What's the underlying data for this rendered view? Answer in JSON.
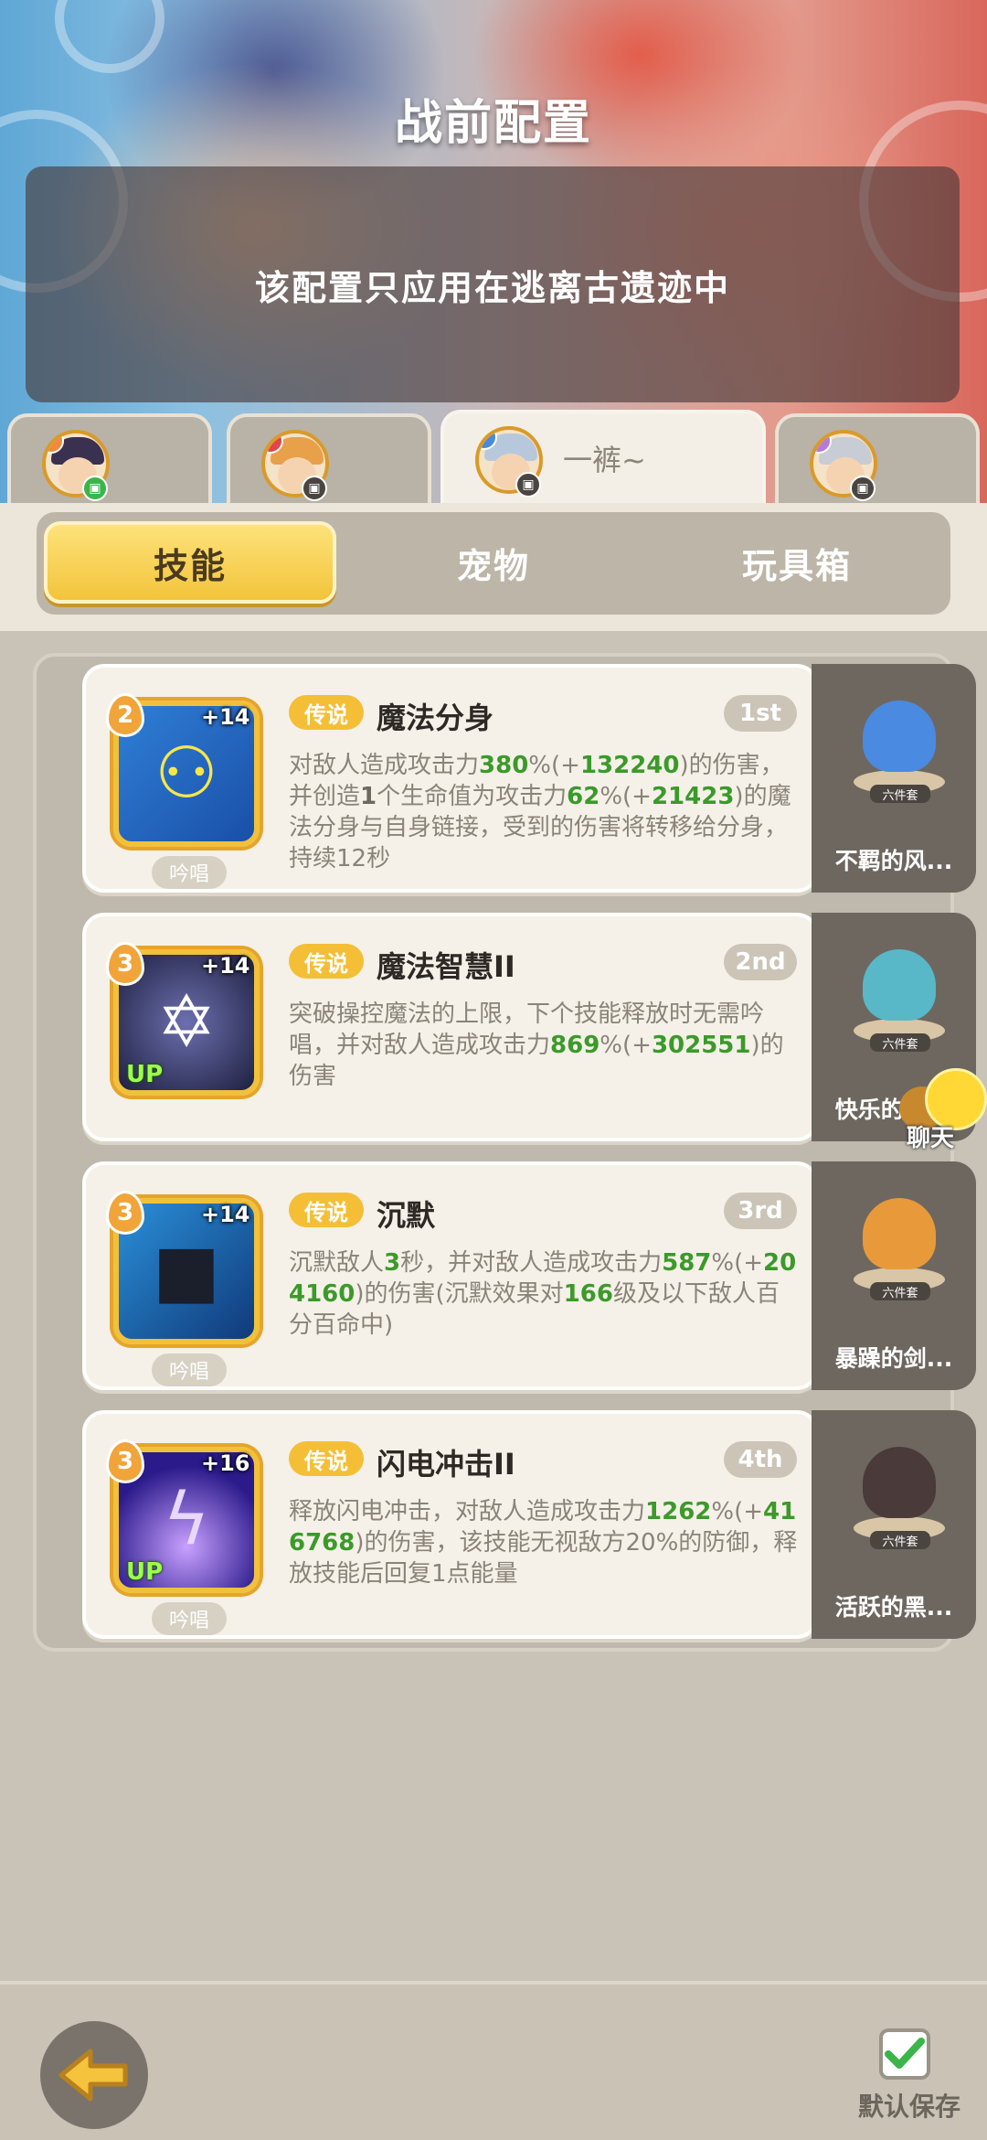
{
  "header": {
    "title": "战前配置",
    "notice": "该配置只应用在逃离古遗迹中"
  },
  "char_tabs": [
    {
      "name": "",
      "active": false,
      "badge": "green"
    },
    {
      "name": "",
      "active": false,
      "badge": "dark"
    },
    {
      "name": "一裤~",
      "active": true,
      "badge": "dark"
    },
    {
      "name": "",
      "active": false,
      "badge": "dark"
    }
  ],
  "sub_tabs": {
    "skills": "技能",
    "pets": "宠物",
    "toybox": "玩具箱"
  },
  "skills": [
    {
      "level": "2",
      "plus": "+14",
      "up": "",
      "chant": "吟唱",
      "rarity": "传说",
      "name": "魔法分身",
      "rank": "1st",
      "desc_parts": [
        "对敌人造成攻击力",
        "380",
        "%(+",
        "132240",
        ")的伤害，并创造",
        "1",
        "个生命值为攻击力",
        "62",
        "%(+",
        "21423",
        ")的魔法分身与自身链接，受到的伤害将转移给分身，持续12秒"
      ],
      "pet_name": "不羁的风...",
      "set": "六件套"
    },
    {
      "level": "3",
      "plus": "+14",
      "up": "UP",
      "chant": "",
      "rarity": "传说",
      "name": "魔法智慧II",
      "rank": "2nd",
      "desc_parts": [
        "突破操控魔法的上限，下个技能释放时无需吟唱，并对敌人造成攻击力",
        "869",
        "%(+",
        "302551",
        ")的伤害"
      ],
      "pet_name": "快乐的雪...",
      "set": "六件套"
    },
    {
      "level": "3",
      "plus": "+14",
      "up": "",
      "chant": "吟唱",
      "rarity": "传说",
      "name": "沉默",
      "rank": "3rd",
      "desc_parts": [
        "沉默敌人",
        "3",
        "秒，并对敌人造成攻击力",
        "587",
        "%(+",
        "204160",
        ")的伤害(沉默效果对",
        "166",
        "级及以下敌人百分百命中)"
      ],
      "pet_name": "暴躁的剑...",
      "set": "六件套"
    },
    {
      "level": "3",
      "plus": "+16",
      "up": "UP",
      "chant": "吟唱",
      "rarity": "传说",
      "name": "闪电冲击II",
      "rank": "4th",
      "desc_parts": [
        "释放闪电冲击，对敌人造成攻击力",
        "1262",
        "%(+",
        "416768",
        ")的伤害，该技能无视敌方20%的防御，释放技能后回复1点能量"
      ],
      "pet_name": "活跃的黑...",
      "set": "六件套"
    }
  ],
  "chat": {
    "label": "聊天"
  },
  "bottom": {
    "save_label": "默认保存",
    "save_checked": true
  },
  "colors": {
    "accent": "#f4bf36",
    "highlight": "#3b9a2a",
    "panel": "#f5f1e8"
  }
}
